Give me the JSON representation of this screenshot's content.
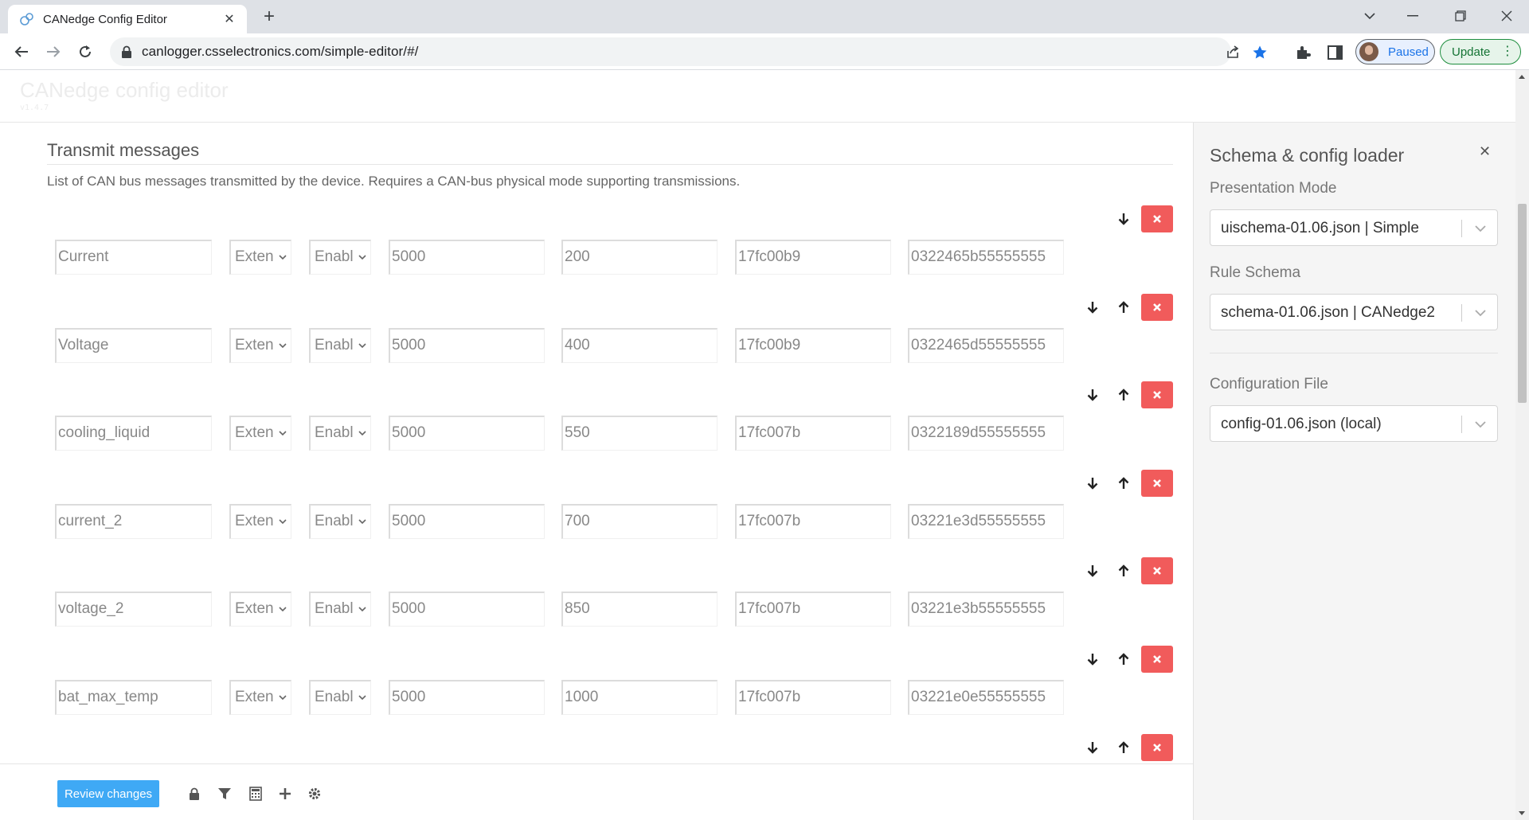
{
  "browser": {
    "tab_title": "CANedge Config Editor",
    "url": "canlogger.csselectronics.com/simple-editor/#/",
    "profile_label": "Paused",
    "update_label": "Update"
  },
  "app": {
    "title": "CANedge config editor",
    "version": "v1.4.7"
  },
  "section": {
    "title": "Transmit messages",
    "description": "List of CAN bus messages transmitted by the device. Requires a CAN-bus physical mode supporting transmissions."
  },
  "messages": [
    {
      "name": "Current",
      "id_format": "Exten",
      "state": "Enabl",
      "period": "5000",
      "delay": "200",
      "id": "17fc00b9",
      "data": "0322465b55555555"
    },
    {
      "name": "Voltage",
      "id_format": "Exten",
      "state": "Enabl",
      "period": "5000",
      "delay": "400",
      "id": "17fc00b9",
      "data": "0322465d55555555"
    },
    {
      "name": "cooling_liquid",
      "id_format": "Exten",
      "state": "Enabl",
      "period": "5000",
      "delay": "550",
      "id": "17fc007b",
      "data": "0322189d55555555"
    },
    {
      "name": "current_2",
      "id_format": "Exten",
      "state": "Enabl",
      "period": "5000",
      "delay": "700",
      "id": "17fc007b",
      "data": "03221e3d55555555"
    },
    {
      "name": "voltage_2",
      "id_format": "Exten",
      "state": "Enabl",
      "period": "5000",
      "delay": "850",
      "id": "17fc007b",
      "data": "03221e3b55555555"
    },
    {
      "name": "bat_max_temp",
      "id_format": "Exten",
      "state": "Enabl",
      "period": "5000",
      "delay": "1000",
      "id": "17fc007b",
      "data": "03221e0e55555555"
    }
  ],
  "footer": {
    "review_label": "Review changes"
  },
  "panel": {
    "title": "Schema & config loader",
    "presentation_label": "Presentation Mode",
    "presentation_value": "uischema-01.06.json | Simple",
    "rule_label": "Rule Schema",
    "rule_value": "schema-01.06.json | CANedge2",
    "config_label": "Configuration File",
    "config_value": "config-01.06.json (local)"
  },
  "colors": {
    "delete": "#f15b5b",
    "review": "#3fa9f5",
    "bookmark_star": "#1a73e8"
  }
}
